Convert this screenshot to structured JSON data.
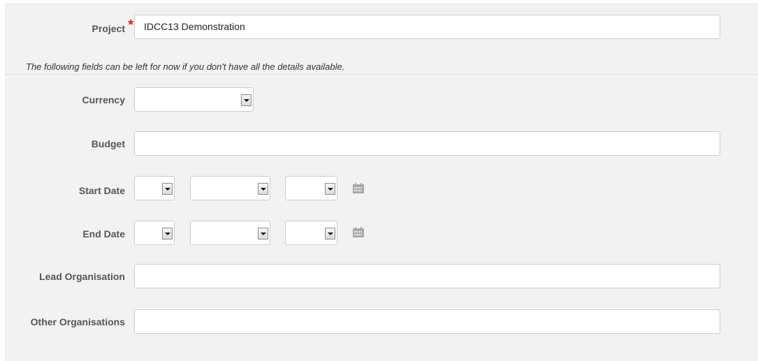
{
  "form": {
    "project": {
      "label": "Project",
      "required_mark": "*",
      "value": "IDCC13 Demonstration"
    },
    "note": "The following fields can be left for now if you don't have all the details available.",
    "currency": {
      "label": "Currency",
      "value": ""
    },
    "budget": {
      "label": "Budget",
      "value": ""
    },
    "start_date": {
      "label": "Start Date",
      "day": "",
      "month": "",
      "year": "",
      "icon": "calendar-icon"
    },
    "end_date": {
      "label": "End Date",
      "day": "",
      "month": "",
      "year": "",
      "icon": "calendar-icon"
    },
    "lead_organisation": {
      "label": "Lead Organisation",
      "value": ""
    },
    "other_organisations": {
      "label": "Other Organisations",
      "value": ""
    }
  },
  "colors": {
    "required": "#d9261c",
    "panel_bg": "#f2f2f2",
    "input_border": "#cccccc",
    "calendar_icon": "#a8a8a8"
  }
}
